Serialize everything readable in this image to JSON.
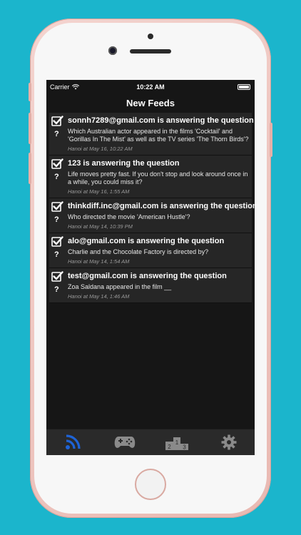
{
  "status_bar": {
    "carrier": "Carrier",
    "time": "10:22 AM"
  },
  "nav": {
    "title": "New Feeds"
  },
  "feed": [
    {
      "title": "sonnh7289@gmail.com is answering the question",
      "question": "Which Australian actor appeared in the films 'Cocktail' and 'Gorillas In The Mist' as well as the TV series 'The Thorn Birds'?",
      "meta": "Hanoi at May 16, 10:22 AM"
    },
    {
      "title": "123 is answering the question",
      "question": "Life moves pretty fast. If you don't stop and look around once in a while, you could miss it?",
      "meta": "Hanoi at May 16, 1:55 AM"
    },
    {
      "title": "thinkdiff.inc@gmail.com is answering the question",
      "question": "Who directed the movie 'American Hustle'?",
      "meta": "Hanoi at May 14, 10:39 PM"
    },
    {
      "title": "alo@gmail.com is answering the question",
      "question": "Charlie and the Chocolate Factory is directed by?",
      "meta": "Hanoi at May 14, 1:54 AM"
    },
    {
      "title": "test@gmail.com is answering the question",
      "question": "Zoa Saldana appeared in the film __",
      "meta": "Hanoi at May 14, 1:46 AM"
    }
  ],
  "tabs": [
    {
      "icon": "rss-feed-icon",
      "active": true
    },
    {
      "icon": "gamepad-icon",
      "active": false
    },
    {
      "icon": "podium-icon",
      "active": false,
      "labels": [
        "2",
        "1",
        "3"
      ]
    },
    {
      "icon": "gear-icon",
      "active": false
    }
  ],
  "colors": {
    "background": "#1bb5cc",
    "active_tab": "#1e63d6",
    "inactive_tab": "#8a8a8a"
  }
}
